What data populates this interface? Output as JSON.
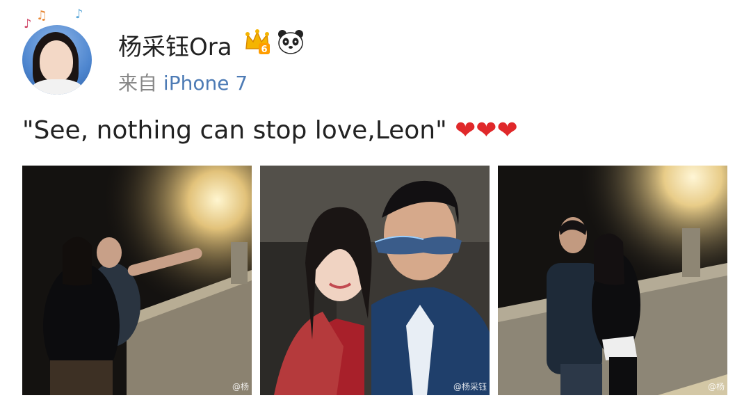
{
  "post": {
    "author": {
      "name": "杨采钰Ora",
      "avatar_icon": "avatar-portrait",
      "badges": [
        "crown-vip-icon",
        "panda-icon"
      ],
      "crown_level": "6"
    },
    "source": {
      "prefix": "来自",
      "device": "iPhone 7"
    },
    "text": "\"See, nothing can stop love,Leon\"",
    "hearts": "❤❤❤",
    "photos": [
      {
        "name": "night-selfie-by-railing",
        "watermark": "@杨"
      },
      {
        "name": "selfie-with-sunglasses",
        "watermark": "@杨采钰"
      },
      {
        "name": "night-phone-by-railing",
        "watermark": "@杨"
      }
    ]
  },
  "colors": {
    "link_blue": "#4d7bb5",
    "meta_gray": "#888888",
    "heart_red": "#e0282a"
  }
}
